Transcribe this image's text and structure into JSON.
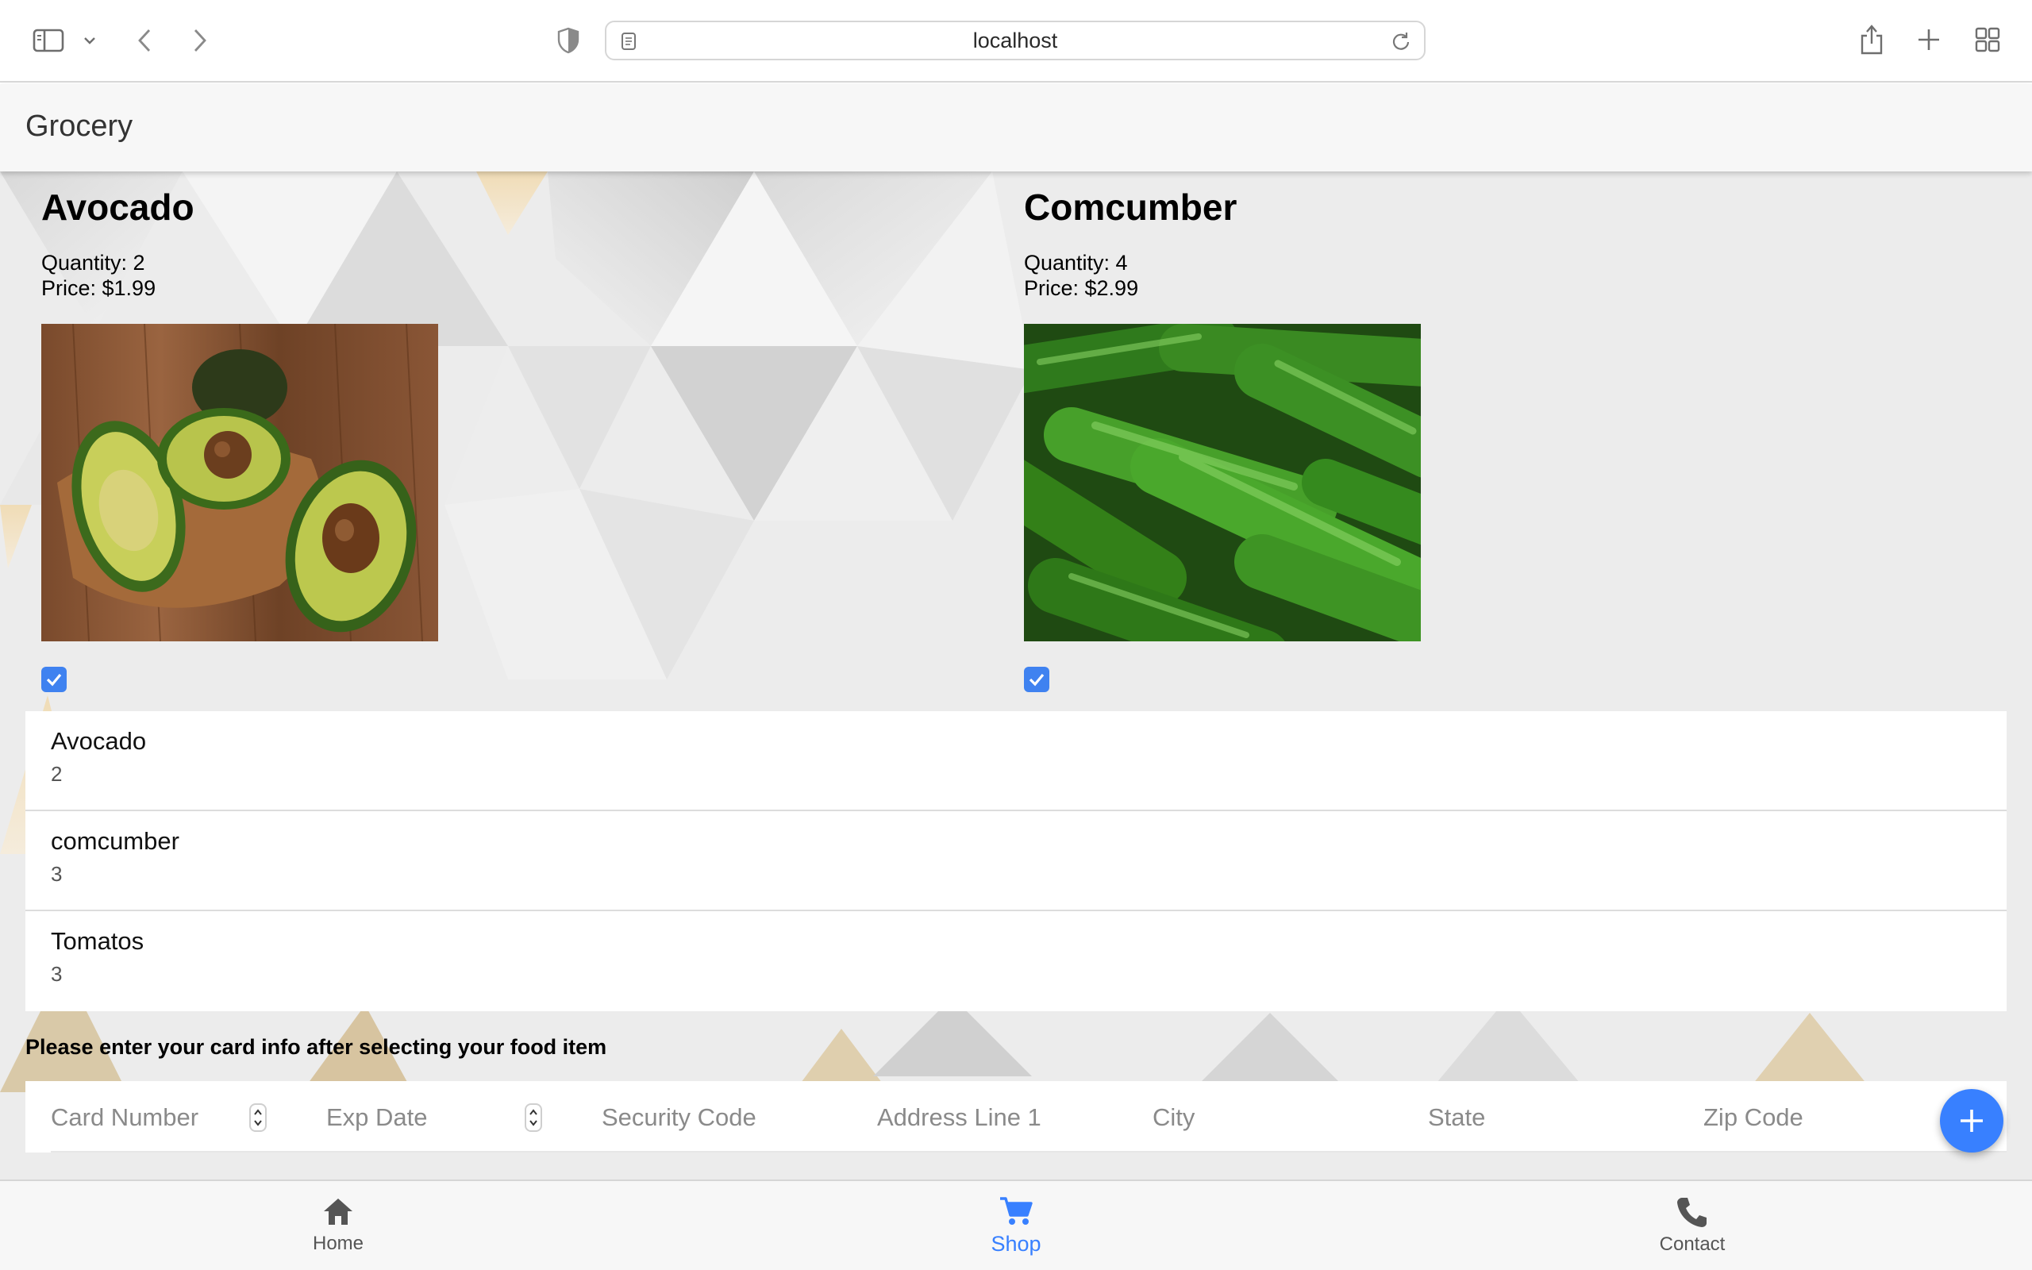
{
  "browser": {
    "url": "localhost",
    "icons": [
      "sidebar-icon",
      "chevron-down-icon",
      "back-icon",
      "forward-icon",
      "shield-icon",
      "page-icon",
      "reload-icon",
      "share-icon",
      "plus-icon",
      "tabs-grid-icon"
    ]
  },
  "app": {
    "title": "Grocery"
  },
  "products": [
    {
      "name": "Avocado",
      "quantity": "Quantity: 2",
      "price": "Price: $1.99",
      "checked": true,
      "image": "avocado-photo"
    },
    {
      "name": "Comcumber",
      "quantity": "Quantity: 4",
      "price": "Price: $2.99",
      "checked": true,
      "image": "cucumber-photo"
    }
  ],
  "list": [
    {
      "name": "Avocado",
      "qty": "2"
    },
    {
      "name": "comcumber",
      "qty": "3"
    },
    {
      "name": "Tomatos",
      "qty": "3"
    }
  ],
  "card_prompt": "Please enter your card info after selecting your food item",
  "card_form": {
    "card_number": "Card Number",
    "exp_date": "Exp Date",
    "security_code": "Security Code",
    "address": "Address Line 1",
    "city": "City",
    "state": "State",
    "zip": "Zip Code"
  },
  "tabs": [
    {
      "label": "Home",
      "icon": "home-icon",
      "selected": false
    },
    {
      "label": "Shop",
      "icon": "cart-icon",
      "selected": true
    },
    {
      "label": "Contact",
      "icon": "phone-icon",
      "selected": false
    }
  ],
  "colors": {
    "accent": "#3880ff",
    "checkbox": "#3f82f0"
  }
}
